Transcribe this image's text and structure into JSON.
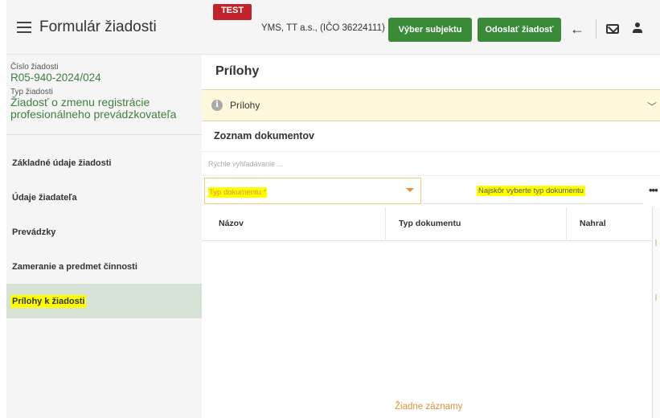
{
  "app": {
    "title": "Formulár žiadosti",
    "menu_icon": "hamburger-menu-icon"
  },
  "header": {
    "badge": "TEST",
    "subject": "YMS, TT a.s., (IČO 36224111)",
    "select_subject_label": "Výber subjektu",
    "send_request_label": "Odoslať žiadosť",
    "icons": [
      "back-arrow-icon",
      "mail-icon",
      "user-icon"
    ]
  },
  "request": {
    "number_label": "Číslo žiadosti",
    "number_value": "R05-940-2024/024",
    "type_label": "Typ žiadosti",
    "type_value": "Žiadosť o zmenu registrácie profesionálneho prevádzkovateľa"
  },
  "sidebar": {
    "items": [
      {
        "label": "Základné údaje žiadosti",
        "active": false
      },
      {
        "label": "Údaje žiadateľa",
        "active": false
      },
      {
        "label": "Prevádzky",
        "active": false
      },
      {
        "label": "Zameranie a predmet činnosti",
        "active": false
      },
      {
        "label": "Prílohy k žiadosti",
        "active": true
      }
    ]
  },
  "main": {
    "page_title": "Prílohy",
    "accordion_label": "Prílohy",
    "documents_title": "Zoznam dokumentov",
    "quick_search_placeholder": "Rýchle vyhľadávanie ...",
    "type_select_placeholder": "Typ dokumentu *",
    "doc_input_text": "Najskôr vyberte typ dokumentu",
    "more_label": "•••",
    "table": {
      "columns": [
        "Názov",
        "Typ dokumentu",
        "Nahral"
      ],
      "empty_text": "Žiadne záznamy"
    }
  },
  "colors": {
    "primary_green": "#3a8a3a",
    "test_badge": "#c0232b",
    "accordion_bg": "#fff8dc",
    "highlight": "#ffff00",
    "empty_text": "#e0913b",
    "sidebar_active_bg": "#d6e2d6"
  }
}
